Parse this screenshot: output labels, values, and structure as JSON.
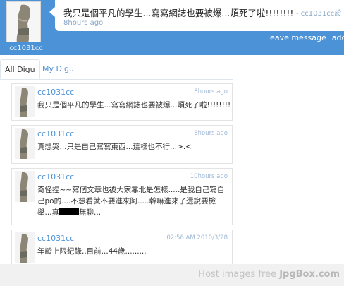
{
  "profile": {
    "name": "cc1031cc"
  },
  "latest": {
    "text": "我只是個平凡的學生...寫寫網誌也要被爆...煩死了啦!!!!!!!!",
    "author": "- cc1031cc於",
    "time": "8hours ago"
  },
  "header_links": {
    "leave_message": "leave message",
    "add_friend": "add fri"
  },
  "tabs": [
    {
      "label": "All Digu",
      "active": true
    },
    {
      "label": "My Digu",
      "active": false
    }
  ],
  "entries": [
    {
      "author": "cc1031cc",
      "time": "8hours ago",
      "text": "我只是個平凡的學生...寫寫網誌也要被爆...煩死了啦!!!!!!!!"
    },
    {
      "author": "cc1031cc",
      "time": "8hours ago",
      "text": "真想哭...只是自己寫寫東西...這樣也不行...>.<"
    },
    {
      "author": "cc1031cc",
      "time": "10hours ago",
      "line1": "奇怪捏~~寫個文章也被大家靠北是怎樣.....是我自己寫自",
      "line2": "己po的....不想看就不要進來阿.....幹嘛進來了還說要檢",
      "line3_a": "舉...真",
      "line3_b": "無聊..."
    },
    {
      "author": "cc1031cc",
      "time": "02:56 AM 2010/3/28",
      "text": "年齡上限紀錄..目前...44歲........."
    }
  ],
  "watermark": {
    "prefix": "Host images free",
    "brand": "JpgBox.com"
  }
}
